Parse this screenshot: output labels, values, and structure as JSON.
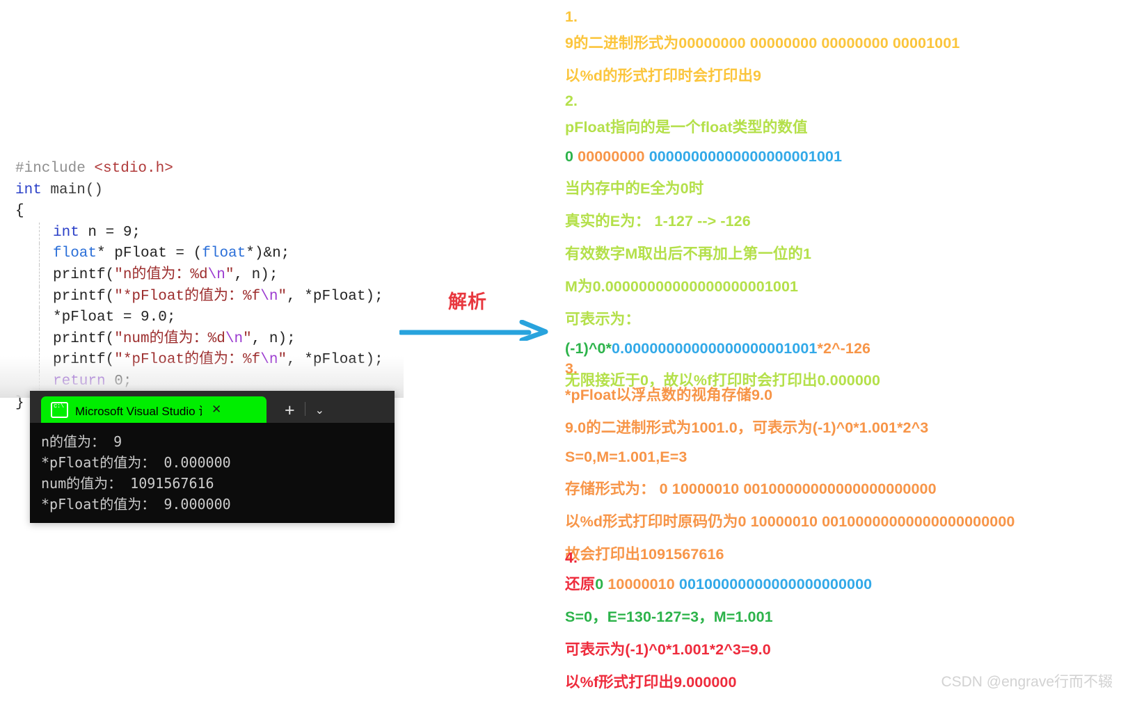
{
  "code_panel": {
    "lines": [
      [
        {
          "t": "#include ",
          "c": "pre"
        },
        {
          "t": "<stdio.h>",
          "c": "inc"
        }
      ],
      [
        {
          "t": "int ",
          "c": "kw"
        },
        {
          "t": "main()",
          "c": "fn"
        }
      ],
      [
        {
          "t": "{",
          "c": "plain"
        }
      ],
      [
        {
          "t": "int ",
          "c": "kw"
        },
        {
          "t": "n = 9;",
          "c": "plain"
        }
      ],
      [
        {
          "t": "float",
          "c": "type"
        },
        {
          "t": "* pFloat = (",
          "c": "plain"
        },
        {
          "t": "float",
          "c": "type"
        },
        {
          "t": "*)&n;",
          "c": "plain"
        }
      ],
      [
        {
          "t": "printf(",
          "c": "plain"
        },
        {
          "t": "\"n的值为：%d",
          "c": "str"
        },
        {
          "t": "\\n",
          "c": "esc"
        },
        {
          "t": "\"",
          "c": "str"
        },
        {
          "t": ", n);",
          "c": "plain"
        }
      ],
      [
        {
          "t": "printf(",
          "c": "plain"
        },
        {
          "t": "\"*pFloat的值为：%f",
          "c": "str"
        },
        {
          "t": "\\n",
          "c": "esc"
        },
        {
          "t": "\"",
          "c": "str"
        },
        {
          "t": ", *pFloat);",
          "c": "plain"
        }
      ],
      [
        {
          "t": "*pFloat = 9.0;",
          "c": "plain"
        }
      ],
      [
        {
          "t": "printf(",
          "c": "plain"
        },
        {
          "t": "\"num的值为：%d",
          "c": "str"
        },
        {
          "t": "\\n",
          "c": "esc"
        },
        {
          "t": "\"",
          "c": "str"
        },
        {
          "t": ", n);",
          "c": "plain"
        }
      ],
      [
        {
          "t": "printf(",
          "c": "plain"
        },
        {
          "t": "\"*pFloat的值为：%f",
          "c": "str"
        },
        {
          "t": "\\n",
          "c": "esc"
        },
        {
          "t": "\"",
          "c": "str"
        },
        {
          "t": ", *pFloat);",
          "c": "plain"
        }
      ],
      [
        {
          "t": "return ",
          "c": "ret"
        },
        {
          "t": "0;",
          "c": "plain"
        }
      ],
      [
        {
          "t": "}",
          "c": "plain"
        }
      ]
    ],
    "indent_flags": [
      false,
      false,
      false,
      true,
      true,
      true,
      true,
      true,
      true,
      true,
      true,
      false
    ]
  },
  "console": {
    "tab_title": "Microsoft Visual Studio 调试控",
    "cmd_icon": "cmd-icon",
    "close_label": "✕",
    "new_tab_label": "+",
    "chevron_label": "⌄",
    "output": "n的值为： 9\n*pFloat的值为： 0.000000\nnum的值为： 1091567616\n*pFloat的值为： 9.000000"
  },
  "analysis": {
    "label": "解析",
    "arrow_color": "#28a3dd"
  },
  "notes": {
    "sections": [
      {
        "number": "1.",
        "number_color": "c-gold",
        "lines": [
          [
            {
              "t": "9的二进制形式为00000000 00000000 00000000 00001001",
              "c": "c-gold"
            }
          ],
          [
            {
              "t": "以%d的形式打印时会打印出9",
              "c": "c-gold"
            }
          ]
        ]
      },
      {
        "number": "2.",
        "number_color": "c-ltgreen",
        "lines": [
          [
            {
              "t": "pFloat指向的是一个float类型的数值",
              "c": "c-ltgreen"
            }
          ],
          [
            {
              "t": "0 ",
              "c": "c-green"
            },
            {
              "t": "00000000 ",
              "c": "c-orange"
            },
            {
              "t": "00000000000000000001001",
              "c": "c-blue"
            }
          ],
          [
            {
              "t": "当内存中的E全为0时",
              "c": "c-ltgreen"
            }
          ],
          [
            {
              "t": "真实的E为： 1-127 --> -126",
              "c": "c-ltgreen"
            }
          ],
          [
            {
              "t": "有效数字M取出后不再加上第一位的1",
              "c": "c-ltgreen"
            }
          ],
          [
            {
              "t": "M为0.00000000000000000001001",
              "c": "c-ltgreen"
            }
          ],
          [
            {
              "t": "可表示为：",
              "c": "c-ltgreen"
            }
          ],
          [
            {
              "t": "(-1)^0*",
              "c": "c-green"
            },
            {
              "t": "0.00000000000000000001001",
              "c": "c-blue"
            },
            {
              "t": "*2^-126",
              "c": "c-orange"
            }
          ],
          [
            {
              "t": "无限接近于0，故以%f打印时会打印出0.000000",
              "c": "c-ltgreen"
            }
          ]
        ]
      },
      {
        "number": "3.",
        "number_color": "c-orange",
        "lines": [
          [
            {
              "t": "*pFloat以浮点数的视角存储9.0",
              "c": "c-orange"
            }
          ],
          [
            {
              "t": "9.0的二进制形式为1001.0，可表示为(-1)^0*1.001*2^3",
              "c": "c-orange"
            }
          ],
          [
            {
              "t": "S=0,M=1.001,E=3",
              "c": "c-orange"
            }
          ],
          [
            {
              "t": "存储形式为： 0 10000010 00100000000000000000000",
              "c": "c-orange"
            }
          ],
          [
            {
              "t": "以%d形式打印时原码仍为0 10000010 00100000000000000000000",
              "c": "c-orange"
            }
          ],
          [
            {
              "t": "故会打印出1091567616",
              "c": "c-orange"
            }
          ]
        ]
      },
      {
        "number": "4.",
        "number_color": "c-red",
        "lines": [
          [
            {
              "t": "还原",
              "c": "c-red"
            },
            {
              "t": "0 ",
              "c": "c-green"
            },
            {
              "t": "10000010 ",
              "c": "c-orange"
            },
            {
              "t": "00100000000000000000000",
              "c": "c-blue"
            }
          ],
          [
            {
              "t": "S=0，E=130-127=3，M=1.001",
              "c": "c-green"
            }
          ],
          [
            {
              "t": "可表示为(-1)^0*1.001*2^3=9.0",
              "c": "c-red"
            }
          ],
          [
            {
              "t": "以%f形式打印出9.000000",
              "c": "c-red"
            }
          ]
        ]
      }
    ]
  },
  "watermark": {
    "text": "CSDN @engrave行而不辍"
  }
}
